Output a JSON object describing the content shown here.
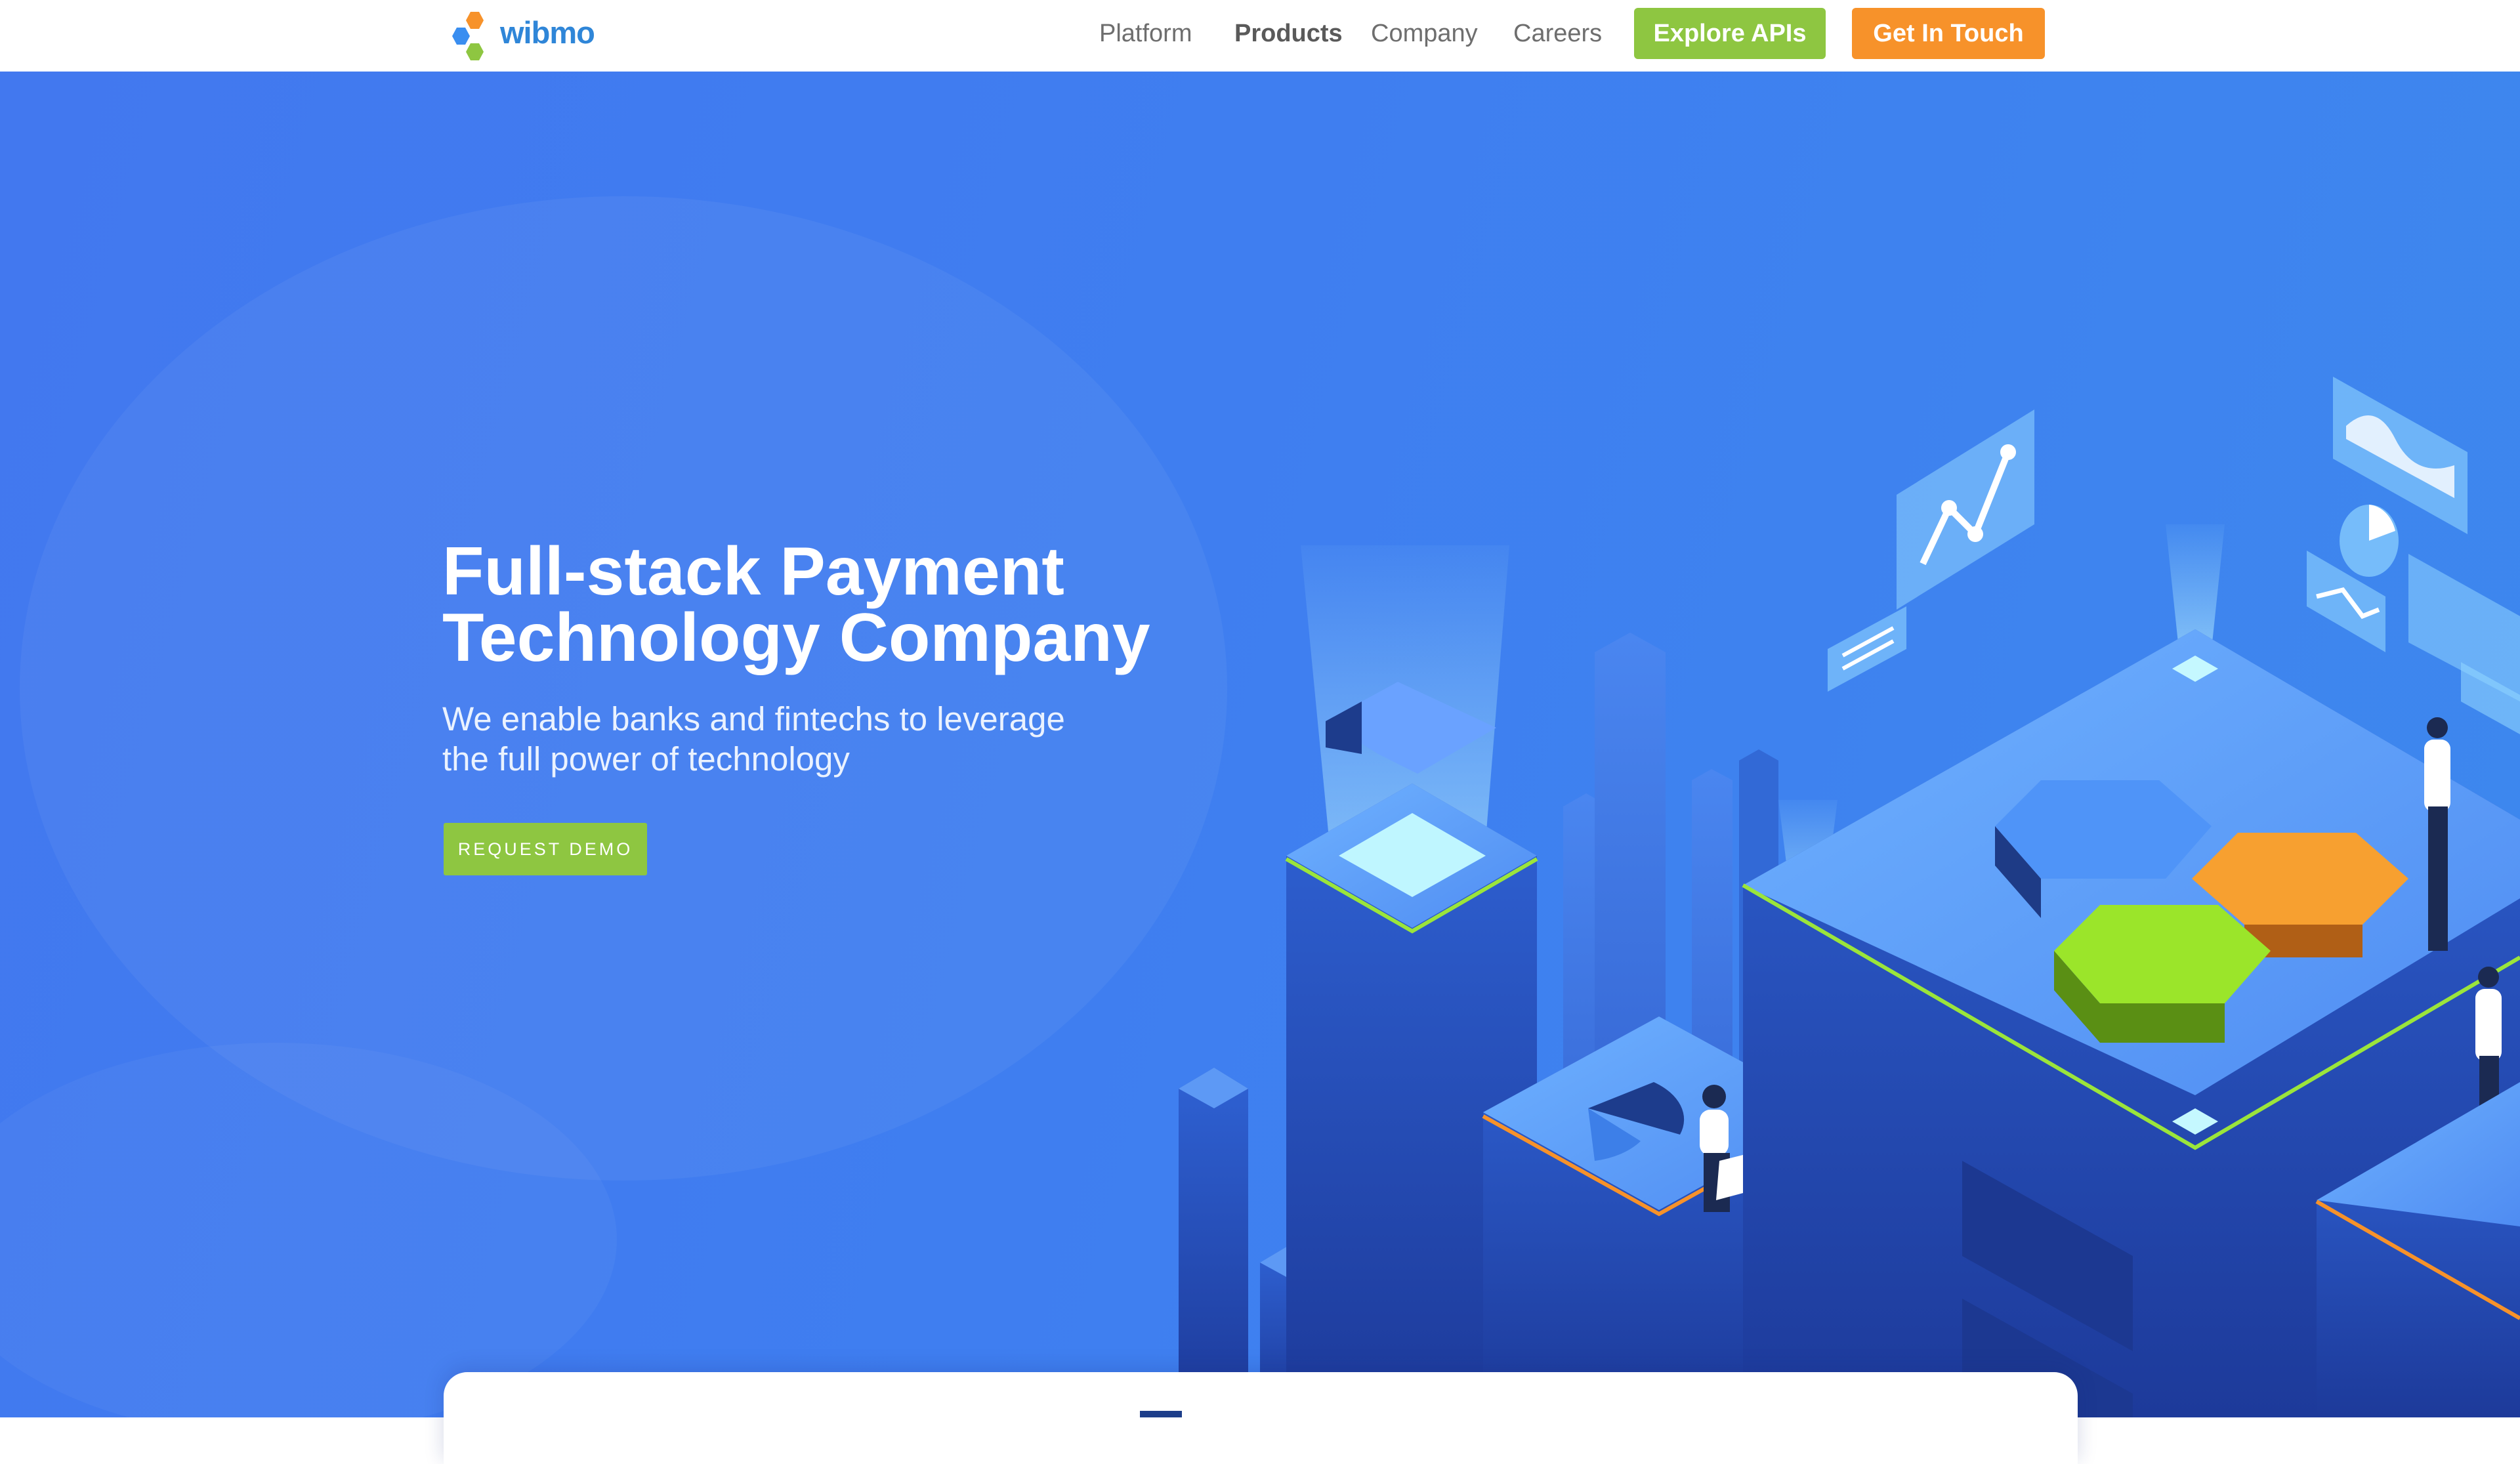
{
  "brand": {
    "name": "wibmo",
    "colors": {
      "blue": "#3a8ef0",
      "orange": "#f7922a",
      "green": "#8ec641"
    }
  },
  "nav": {
    "links": [
      "Platform",
      "Products",
      "Company",
      "Careers"
    ],
    "active": "Products",
    "explore_apis": "Explore APIs",
    "get_in_touch": "Get In Touch"
  },
  "hero": {
    "headline_line1": "Full-stack Payment",
    "headline_line2": "Technology Company",
    "subtext_line1": "We enable banks and fintechs to leverage",
    "subtext_line2": "the full power of technology",
    "cta": "REQUEST DEMO",
    "background_color": "#3f7ef0"
  },
  "icons": [
    "hexagon-logo-icon",
    "line-chart-icon",
    "hexagon-cluster-icon",
    "pie-chart-icon",
    "image-icon"
  ]
}
